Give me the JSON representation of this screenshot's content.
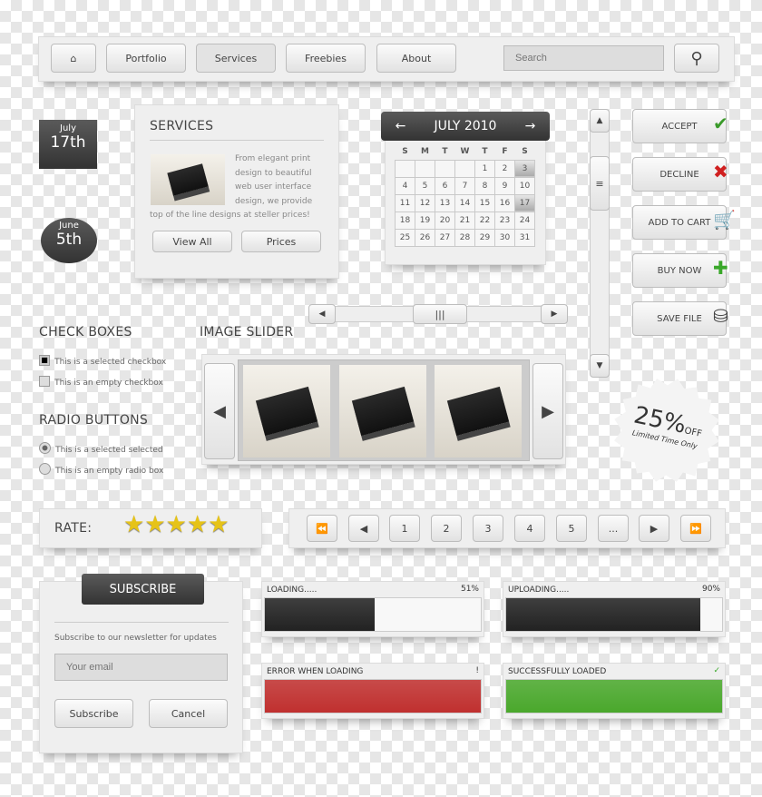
{
  "nav": {
    "items": [
      "Portfolio",
      "Services",
      "Freebies",
      "About"
    ],
    "search_placeholder": "Search"
  },
  "dates": [
    {
      "month": "July",
      "day": "17th"
    },
    {
      "month": "June",
      "day": "5th"
    }
  ],
  "services": {
    "title": "SERVICES",
    "text": "From elegant print design to beautiful web user interface design, we provide top of the line designs at steller prices!",
    "buttons": [
      "View All",
      "Prices"
    ]
  },
  "calendar": {
    "title": "JULY 2010",
    "weekdays": [
      "S",
      "M",
      "T",
      "W",
      "T",
      "F",
      "S"
    ],
    "weeks": [
      [
        "",
        "",
        "",
        "",
        "1",
        "2",
        "3"
      ],
      [
        "4",
        "5",
        "6",
        "7",
        "8",
        "9",
        "10"
      ],
      [
        "11",
        "12",
        "13",
        "14",
        "15",
        "16",
        "17"
      ],
      [
        "18",
        "19",
        "20",
        "21",
        "22",
        "23",
        "24"
      ],
      [
        "25",
        "26",
        "27",
        "28",
        "29",
        "30",
        "31"
      ]
    ],
    "highlighted": [
      "3",
      "17"
    ]
  },
  "actions": [
    "ACCEPT",
    "DECLINE",
    "ADD TO CART",
    "BUY NOW",
    "SAVE FILE"
  ],
  "checkboxes": {
    "title": "CHECK BOXES",
    "items": [
      {
        "label": "This is a selected checkbox",
        "checked": true
      },
      {
        "label": "This is an empty checkbox",
        "checked": false
      }
    ]
  },
  "radios": {
    "title": "RADIO BUTTONS",
    "items": [
      {
        "label": "This is a selected selected",
        "checked": true
      },
      {
        "label": "This is an empty radio box",
        "checked": false
      }
    ]
  },
  "slider": {
    "title": "IMAGE SLIDER"
  },
  "badge": {
    "value": "25%",
    "off": "OFF",
    "sub": "Limited Time Only"
  },
  "rating": {
    "label": "RATE:",
    "stars": 5
  },
  "pagination": {
    "pages": [
      "1",
      "2",
      "3",
      "4",
      "5",
      "..."
    ]
  },
  "subscribe": {
    "title": "SUBSCRIBE",
    "text": "Subscribe to our newsletter for updates",
    "placeholder": "Your email",
    "buttons": [
      "Subscribe",
      "Cancel"
    ]
  },
  "progress": [
    {
      "label": "LOADING.....",
      "value": "51%",
      "fraction": 0.51,
      "color": "#222222"
    },
    {
      "label": "UPLOADING.....",
      "value": "90%",
      "fraction": 0.9,
      "color": "#222222"
    },
    {
      "label": "ERROR WHEN LOADING",
      "value": "!",
      "fraction": 1,
      "color": "#c0302f"
    },
    {
      "label": "SUCCESSFULLY LOADED",
      "value": "✓",
      "fraction": 1,
      "color": "#4aa82c"
    }
  ]
}
